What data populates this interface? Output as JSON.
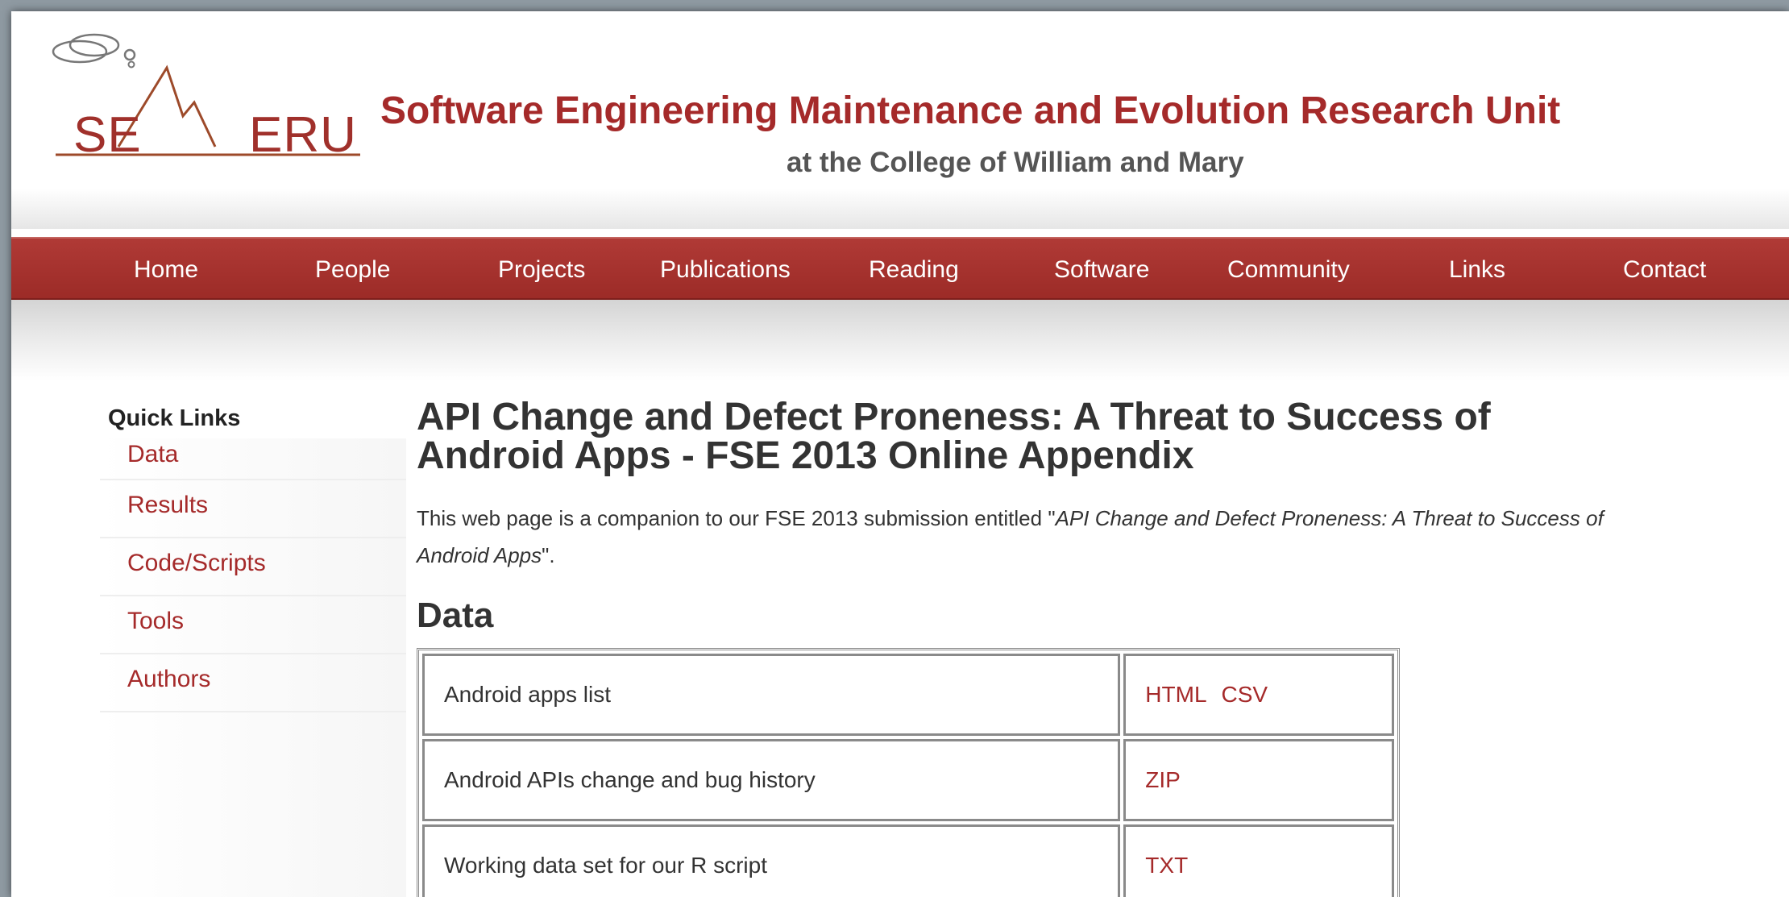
{
  "logo": {
    "left_text": "SE",
    "right_text": "ERU"
  },
  "header": {
    "title": "Software Engineering Maintenance and Evolution Research Unit",
    "subtitle": "at the College of William and Mary"
  },
  "nav": {
    "items": [
      "Home",
      "People",
      "Projects",
      "Publications",
      "Reading",
      "Software",
      "Community",
      "Links",
      "Contact"
    ]
  },
  "sidebar": {
    "title": "Quick Links",
    "items": [
      "Data",
      "Results",
      "Code/Scripts",
      "Tools",
      "Authors"
    ]
  },
  "main": {
    "title": "API Change and Defect Proneness: A Threat to Success of Android Apps - FSE 2013 Online Appendix",
    "intro_before": "This web page is a companion to our FSE 2013 submission entitled \"",
    "intro_em": "API Change and Defect Proneness: A Threat to Success of Android Apps",
    "intro_after": "\".",
    "section_title": "Data",
    "table": [
      {
        "description": "Android apps list",
        "links": [
          "HTML",
          "CSV"
        ]
      },
      {
        "description": "Android APIs change and bug history",
        "links": [
          "ZIP"
        ]
      },
      {
        "description": "Working data set for our R script",
        "links": [
          "TXT"
        ]
      }
    ]
  },
  "colors": {
    "accent": "#a52a2a",
    "nav_background": "#9c2b27",
    "text": "#333333"
  }
}
